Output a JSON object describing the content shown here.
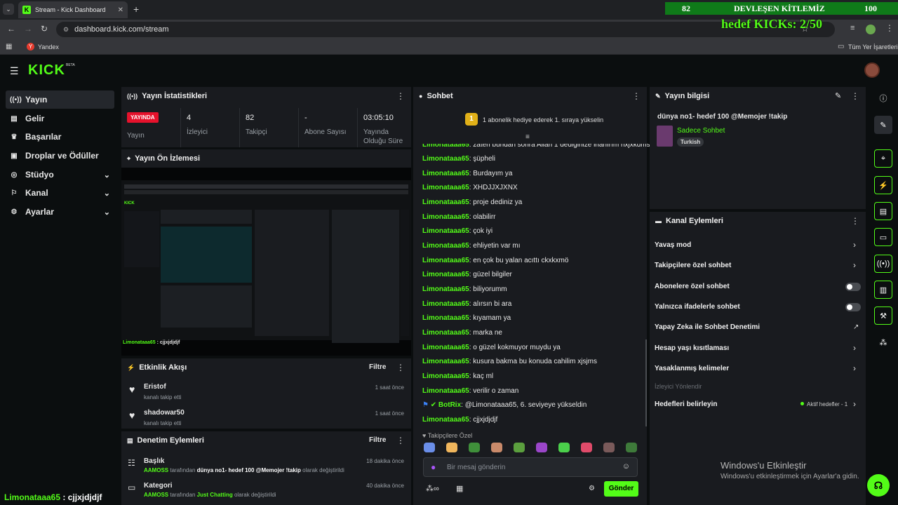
{
  "browser": {
    "tab_title": "Stream - Kick Dashboard",
    "url": "dashboard.kick.com/stream",
    "bookmark": "Yandex",
    "bookmarks_right": "Tüm Yer İşaretleri"
  },
  "overlay": {
    "left_num": "82",
    "title": "DEVLEŞEN KİTLEMİZ",
    "right_num": "100",
    "goal": "hedef KICKs: 2/50"
  },
  "app": {
    "logo": "KICK",
    "beta": "BETA"
  },
  "sidebar": {
    "items": [
      {
        "label": "Yayın",
        "icon": "broadcast-icon"
      },
      {
        "label": "Gelir",
        "icon": "revenue-icon"
      },
      {
        "label": "Başarılar",
        "icon": "trophy-icon"
      },
      {
        "label": "Droplar ve Ödüller",
        "icon": "gift-icon"
      },
      {
        "label": "Stüdyo",
        "icon": "studio-icon"
      },
      {
        "label": "Kanal",
        "icon": "channel-icon"
      },
      {
        "label": "Ayarlar",
        "icon": "gear-icon"
      }
    ]
  },
  "stats": {
    "title": "Yayın İstatistikleri",
    "live_badge": "YAYINDA",
    "live_label": "Yayın",
    "viewers": "4",
    "viewers_label": "İzleyici",
    "followers": "82",
    "followers_label": "Takipçi",
    "subs": "-",
    "subs_label": "Abone Sayısı",
    "uptime": "03:05:10",
    "uptime_label": "Yayında Olduğu Süre"
  },
  "preview": {
    "title": "Yayın Ön İzlemesi",
    "caption_user": "Limonataaa65",
    "caption_msg": "cjjxjdjdjf"
  },
  "activity": {
    "title": "Etkinlik Akışı",
    "filter": "Filtre",
    "items": [
      {
        "name": "Eristof",
        "desc": "kanalı takip etti",
        "time": "1 saat önce"
      },
      {
        "name": "shadowar50",
        "desc": "kanalı takip etti",
        "time": "1 saat önce"
      }
    ]
  },
  "moderation": {
    "title": "Denetim Eylemleri",
    "filter": "Filtre",
    "items": [
      {
        "title": "Başlık",
        "actor": "AAMOSS",
        "mid": "tarafından",
        "value": "dünya no1- hedef 100 @Memojer !takip",
        "end": "olarak değiştirildi",
        "time": "18 dakika önce"
      },
      {
        "title": "Kategori",
        "actor": "AAMOSS",
        "mid": "tarafından",
        "value": "Just Chatting",
        "end": "olarak değiştirildi",
        "time": "40 dakika önce"
      }
    ]
  },
  "chat": {
    "title": "Sohbet",
    "banner": "1 abonelik hediye ederek 1. sıraya yükselin",
    "banner_num": "1",
    "messages": [
      {
        "user": "Limonataaa65",
        "text": "zaten bundan sonra Allah 1 dediğinize inanırım hxjxkdms"
      },
      {
        "user": "Limonataaa65",
        "text": "şüpheli"
      },
      {
        "user": "Limonataaa65",
        "text": "Burdayım ya"
      },
      {
        "user": "Limonataaa65",
        "text": "XHDJJXJXNX"
      },
      {
        "user": "Limonataaa65",
        "text": "proje dediniz ya"
      },
      {
        "user": "Limonataaa65",
        "text": "olabilirr"
      },
      {
        "user": "Limonataaa65",
        "text": "çok iyi"
      },
      {
        "user": "Limonataaa65",
        "text": "ehliyetin var mı"
      },
      {
        "user": "Limonataaa65",
        "text": "en çok bu yalan acıttı ckxkxmö"
      },
      {
        "user": "Limonataaa65",
        "text": "güzel bilgiler"
      },
      {
        "user": "Limonataaa65",
        "text": "biliyorumm"
      },
      {
        "user": "Limonataaa65",
        "text": "alırsın bi ara"
      },
      {
        "user": "Limonataaa65",
        "text": "kıyamam ya"
      },
      {
        "user": "Limonataaa65",
        "text": "marka ne"
      },
      {
        "user": "Limonataaa65",
        "text": "o güzel kokmuyor muydu ya"
      },
      {
        "user": "Limonataaa65",
        "text": "kusura bakma bu konuda cahilim xjsjms"
      },
      {
        "user": "Limonataaa65",
        "text": "kaç ml"
      },
      {
        "user": "Limonataaa65",
        "text": "verilir o zaman"
      },
      {
        "user": "BotRix",
        "text": "@Limonataaa65, 6. seviyeye yükseldin"
      },
      {
        "user": "Limonataaa65",
        "text": "cjjxjdjdjf"
      }
    ],
    "followers_only": "Takipçilere Özel",
    "placeholder": "Bir mesaj gönderin",
    "send": "Gönder"
  },
  "stream_info": {
    "title": "Yayın bilgisi",
    "stream_title": "dünya no1- hedef 100 @Memojer !takip",
    "category": "Sadece Sohbet",
    "tag": "Turkish"
  },
  "channel_actions": {
    "title": "Kanal Eylemleri",
    "items": [
      {
        "label": "Yavaş mod",
        "control": "chevron"
      },
      {
        "label": "Takipçilere özel sohbet",
        "control": "chevron"
      },
      {
        "label": "Abonelere özel sohbet",
        "control": "toggle"
      },
      {
        "label": "Yalnızca ifadelerle sohbet",
        "control": "toggle"
      },
      {
        "label": "Yapay Zeka ile Sohbet Denetimi",
        "control": "external"
      },
      {
        "label": "Hesap yaşı kısıtlaması",
        "control": "chevron"
      },
      {
        "label": "Yasaklanmış kelimeler",
        "control": "chevron"
      }
    ],
    "section": "İzleyici Yönlendir",
    "goals_label": "Hedefleri belirleyin",
    "goals_status": "Aktif hedefler - 1"
  },
  "windows": {
    "title": "Windows'u Etkinleştir",
    "subtitle": "Windows'u etkinleştirmek için Ayarlar'a gidin."
  },
  "bottom_caption": {
    "user": "Limonataaa65",
    "text": ": cjjxjdjdjf"
  }
}
